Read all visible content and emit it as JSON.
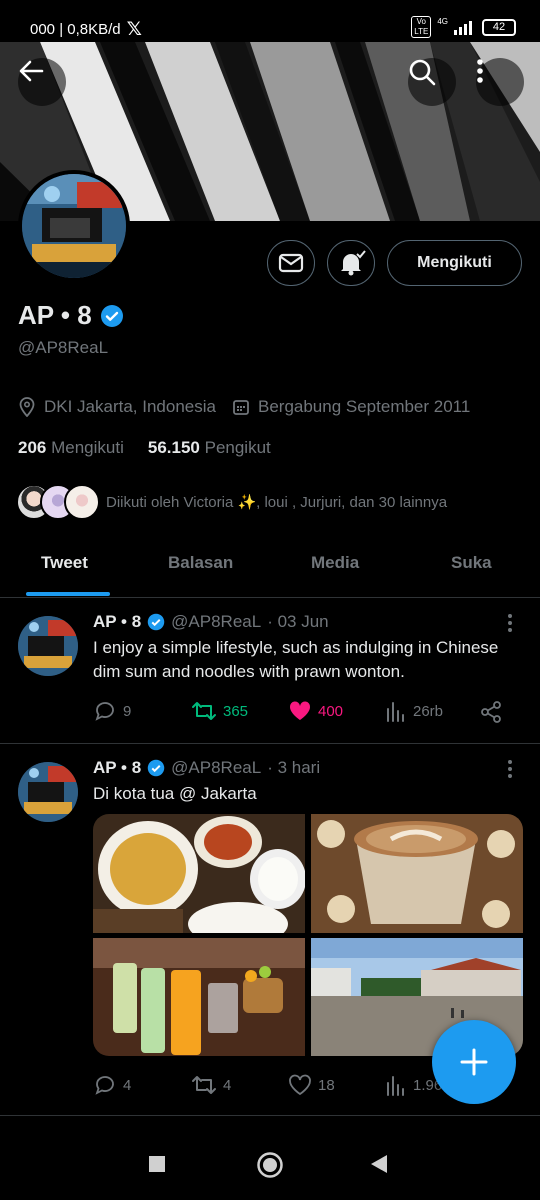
{
  "status_bar": {
    "network_speed": "000 | 0,8KB/d",
    "x_logo": "𝕏",
    "volte_top": "Vo",
    "volte_bottom": "LTE",
    "signal": "4G",
    "battery": "42"
  },
  "profile": {
    "name": "AP • 8",
    "handle": "@AP8ReaL",
    "location": "DKI Jakarta, Indonesia",
    "joined": "Bergabung September 2011",
    "following_count": "206",
    "following_label": "Mengikuti",
    "followers_count": "56.150",
    "followers_label": "Pengikut",
    "followed_by": "Diikuti oleh Victoria ✨, loui    , Jurjuri, dan 30 lainnya",
    "follow_button": "Mengikuti"
  },
  "tabs": [
    {
      "label": "Tweet"
    },
    {
      "label": "Balasan"
    },
    {
      "label": "Media"
    },
    {
      "label": "Suka"
    }
  ],
  "tweets": [
    {
      "name": "AP • 8",
      "handle": "@AP8ReaL",
      "time": "· 03 Jun",
      "text": "I enjoy a simple lifestyle, such as indulging in Chinese dim sum and noodles with prawn wonton.",
      "replies": "9",
      "retweets": "365",
      "likes": "400",
      "views": "26rb"
    },
    {
      "name": "AP • 8",
      "handle": "@AP8ReaL",
      "time": "· 3 hari",
      "text": "Di kota tua @ Jakarta",
      "replies": "4",
      "retweets": "4",
      "likes": "18",
      "views": "1.96"
    }
  ],
  "colors": {
    "accent": "#1d9bf0",
    "retweet": "#00ba7c",
    "like": "#f91880",
    "muted": "#71767b"
  },
  "icons": [
    "back-arrow-icon",
    "search-icon",
    "more-vert-icon",
    "mail-icon",
    "bell-icon",
    "location-icon",
    "calendar-icon",
    "verified-icon",
    "reply-icon",
    "retweet-icon",
    "heart-icon",
    "views-icon",
    "share-icon",
    "plus-icon"
  ]
}
